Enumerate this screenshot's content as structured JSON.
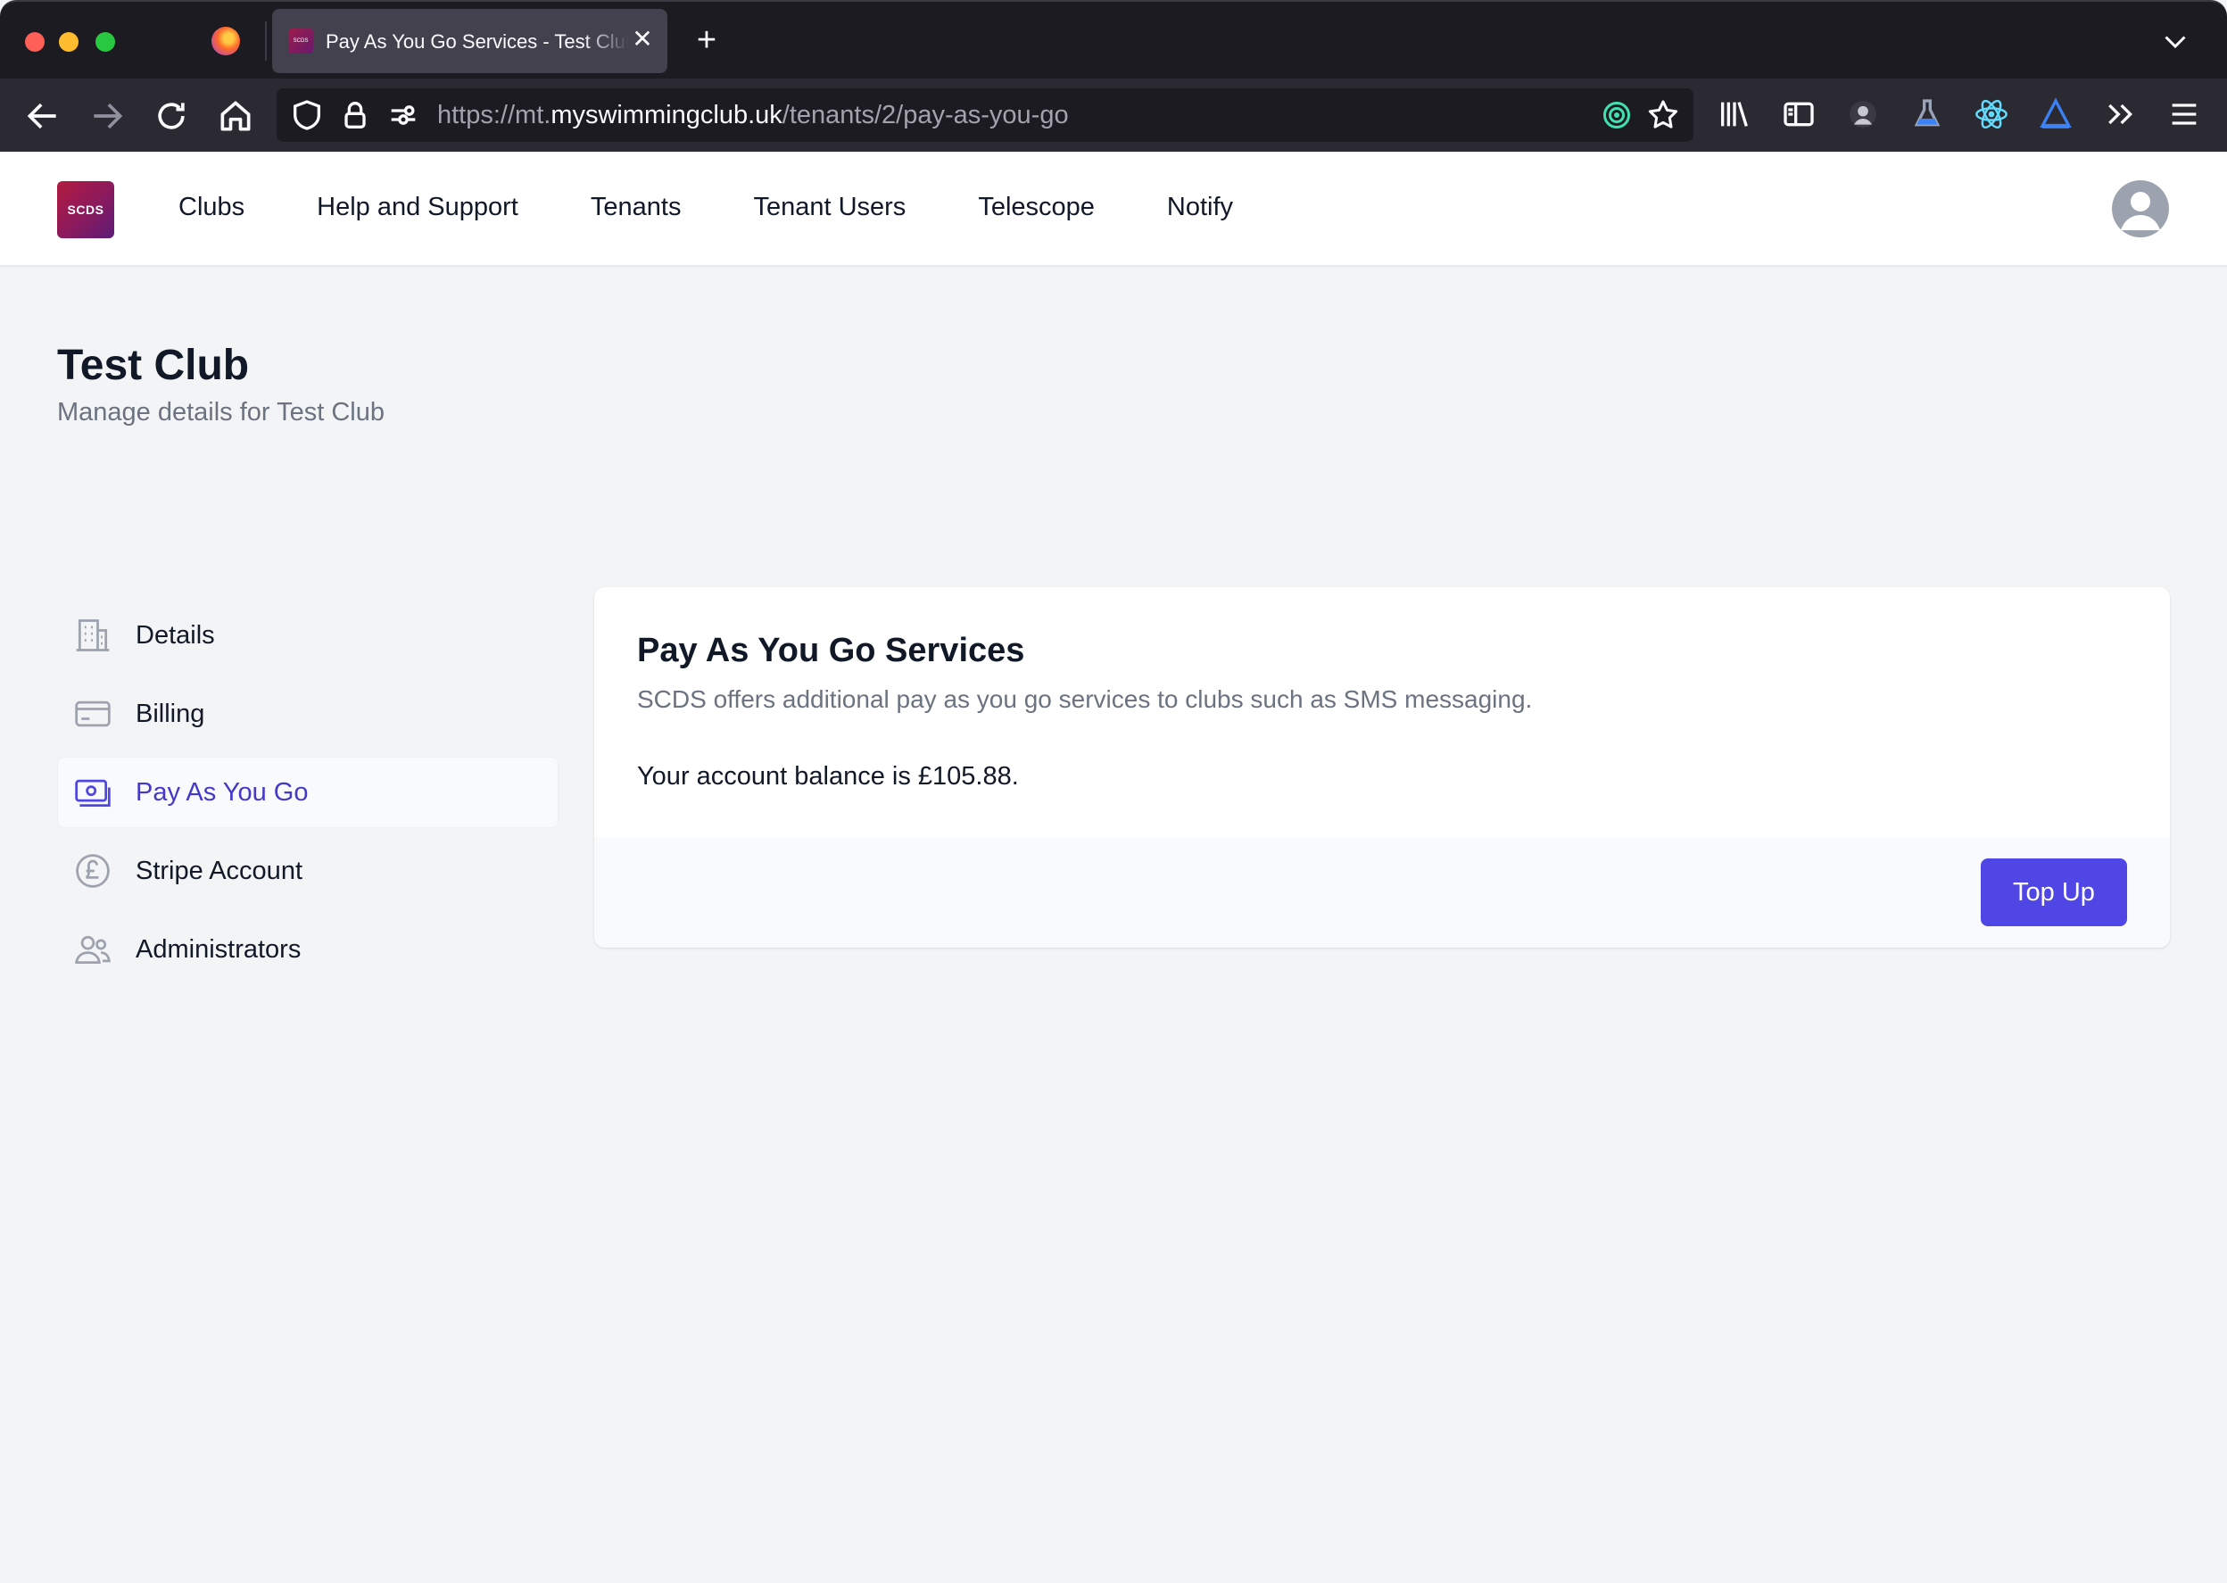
{
  "browser": {
    "tab_title": "Pay As You Go Services - Test Club",
    "tab_favicon_text": "SCDS",
    "url_prefix": "https://mt.",
    "url_host": "myswimmingclub.uk",
    "url_path": "/tenants/2/pay-as-you-go"
  },
  "header": {
    "brand": "SCDS",
    "nav": [
      "Clubs",
      "Help and Support",
      "Tenants",
      "Tenant Users",
      "Telescope",
      "Notify"
    ]
  },
  "page": {
    "title": "Test Club",
    "subtitle": "Manage details for Test Club"
  },
  "sidebar": {
    "items": [
      {
        "label": "Details",
        "icon": "building-icon"
      },
      {
        "label": "Billing",
        "icon": "credit-card-icon"
      },
      {
        "label": "Pay As You Go",
        "icon": "cash-icon",
        "active": true
      },
      {
        "label": "Stripe Account",
        "icon": "pound-icon"
      },
      {
        "label": "Administrators",
        "icon": "users-icon"
      }
    ]
  },
  "card": {
    "title": "Pay As You Go Services",
    "description": "SCDS offers additional pay as you go services to clubs such as SMS messaging.",
    "balance_text": "Your account balance is £105.88.",
    "topup_label": "Top Up"
  },
  "colors": {
    "accent": "#4f46e5",
    "active_text": "#4338ca",
    "page_bg": "#f3f4f6"
  }
}
